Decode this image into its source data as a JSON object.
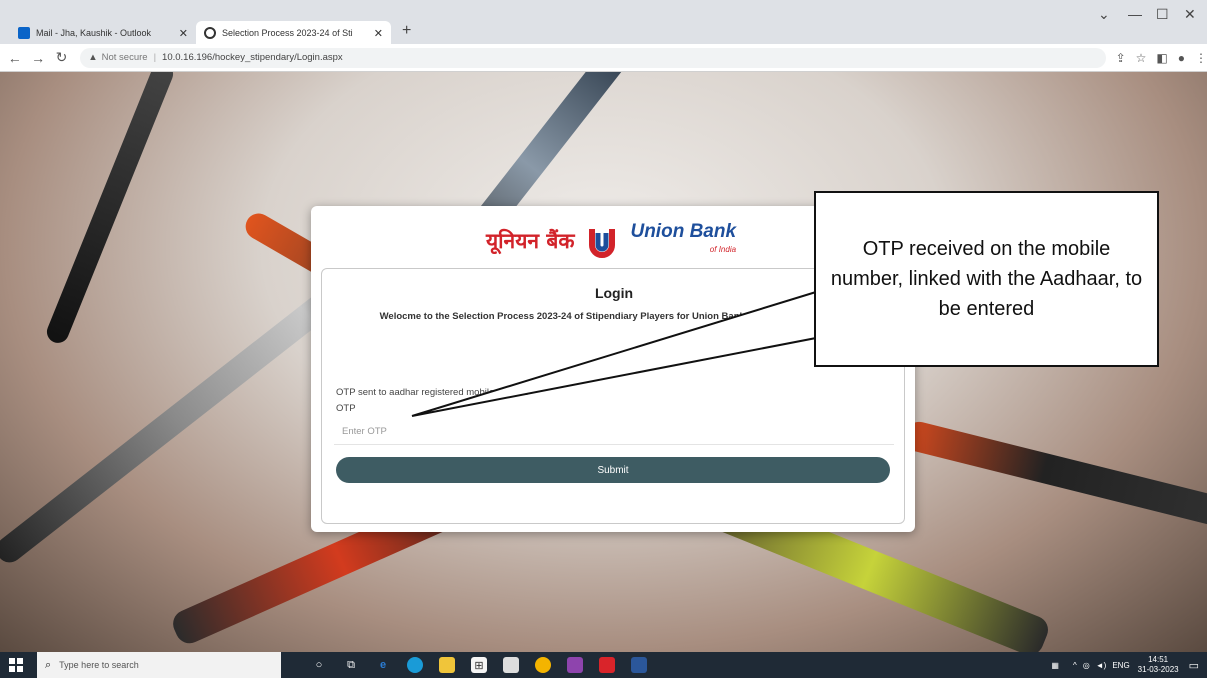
{
  "browser": {
    "tabs": [
      {
        "title": "Mail - Jha, Kaushik - Outlook",
        "fav_color": "#0a64c8"
      },
      {
        "title": "Selection Process 2023-24 of Sti",
        "fav_color": "#333333"
      }
    ],
    "new_tab": "+",
    "address": {
      "security": "Not secure",
      "url": "10.0.16.196/hockey_stipendary/Login.aspx"
    }
  },
  "page": {
    "logo": {
      "hindi": "यूनियन बैंक",
      "english": "Union Bank",
      "english_sub": "of India",
      "brand_red": "#d2232a",
      "brand_blue": "#1e4f9c"
    },
    "login_title": "Login",
    "welcome": "Welocme to the Selection Process 2023-24 of Stipendiary Players for Union Bank of India Hockey Team",
    "otp_sent": "OTP sent to aadhar registered mobile number",
    "otp_label": "OTP",
    "otp_placeholder": "Enter OTP",
    "submit": "Submit",
    "button_color": "#3e5c63"
  },
  "callout": {
    "text": "OTP received on the mobile number, linked with the Aadhaar, to be entered"
  },
  "taskbar": {
    "search_placeholder": "Type here to search",
    "lang": "ENG",
    "time": "14:51",
    "date": "31-03-2023"
  }
}
